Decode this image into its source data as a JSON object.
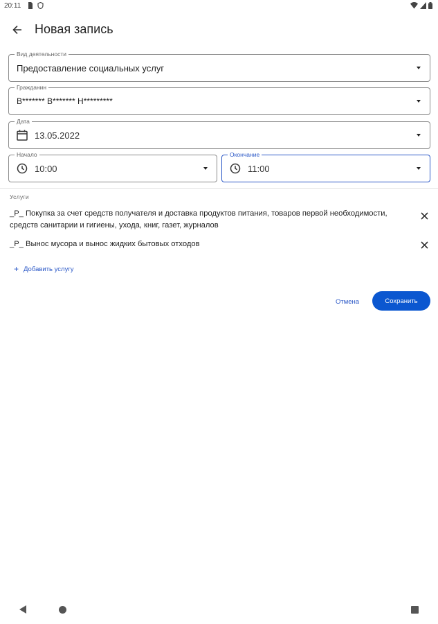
{
  "status_bar": {
    "time": "20:11"
  },
  "app_bar": {
    "title": "Новая запись"
  },
  "form": {
    "activity": {
      "label": "Вид деятельности",
      "value": "Предоставление социальных услуг"
    },
    "citizen": {
      "label": "Гражданин",
      "value": "В*******   В******* Н*********"
    },
    "date": {
      "label": "Дата",
      "value": "13.05.2022"
    },
    "start": {
      "label": "Начало",
      "value": "10:00"
    },
    "end": {
      "label": "Окончание",
      "value": "11:00"
    }
  },
  "services": {
    "label": "Услуги",
    "items": [
      {
        "text": "_Р_ Покупка за счет средств получателя и доставка продуктов питания, товаров первой необходимости, средств санитарии и гигиены, ухода, книг, газет, журналов"
      },
      {
        "text": "_Р_ Вынос мусора и вынос жидких бытовых отходов"
      }
    ],
    "add_label": "Добавить услугу"
  },
  "actions": {
    "cancel": "Отмена",
    "save": "Сохранить"
  },
  "colors": {
    "accent": "#0b57d0",
    "link": "#2b58c7",
    "outline": "#8a8a8a"
  }
}
